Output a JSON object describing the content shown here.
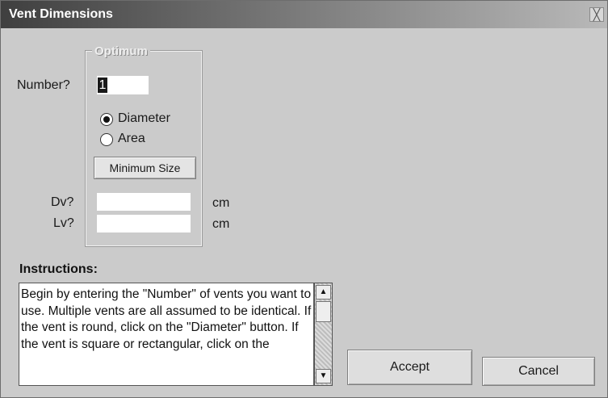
{
  "window": {
    "title": "Vent Dimensions",
    "close_glyph": "╳"
  },
  "form": {
    "number_label": "Number?",
    "number_value": "1",
    "group_title": "Optimum",
    "radio_diameter_label": "Diameter",
    "radio_area_label": "Area",
    "selected_radio": "Diameter",
    "min_size_label": "Minimum Size",
    "dv_label": "Dv?",
    "lv_label": "Lv?",
    "dv_value": "",
    "lv_value": "",
    "dv_unit": "cm",
    "lv_unit": "cm"
  },
  "instructions": {
    "title": "Instructions:",
    "text": "Begin by entering the \"Number\" of vents you want to use. Multiple vents are all assumed to be identical. If the vent is round, click on the \"Diameter\" button. If the vent is square or rectangular, click on the",
    "scroll_up_glyph": "▲",
    "scroll_down_glyph": "▼"
  },
  "buttons": {
    "accept": "Accept",
    "cancel": "Cancel"
  },
  "icons": {
    "close": "close-icon",
    "scroll_up": "arrow-up-icon",
    "scroll_down": "arrow-down-icon"
  }
}
